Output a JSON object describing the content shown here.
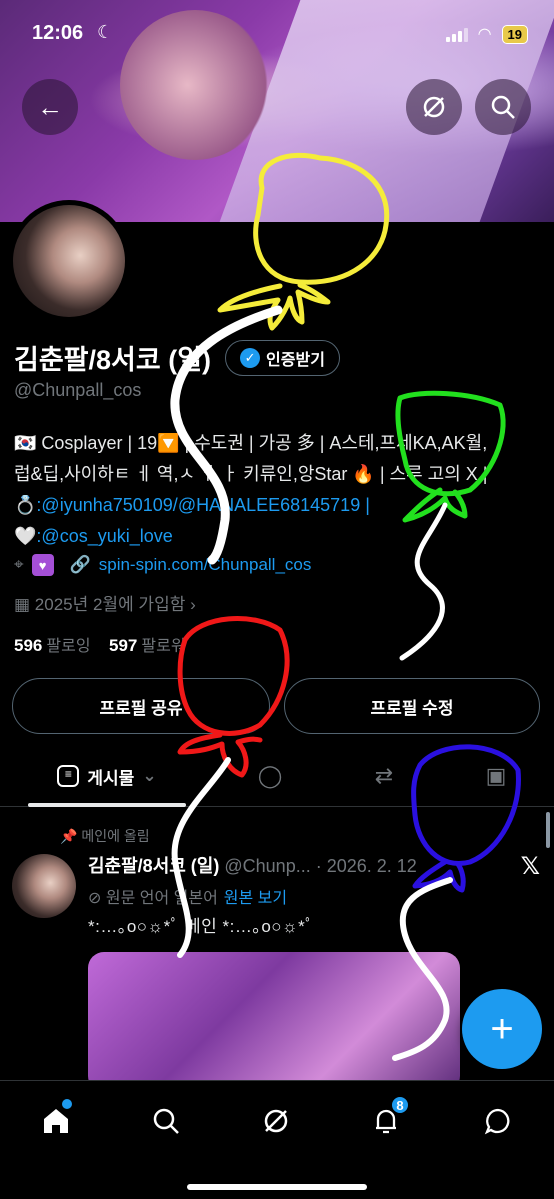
{
  "status": {
    "time": "12:06",
    "battery": "19"
  },
  "profile": {
    "name": "김춘팔/8서코 (일)",
    "verify_label": "인증받기",
    "handle": "@Chunpall_cos",
    "bio_line1": "🇰🇷 Cosplayer | 19🔽 | 수도권 | 가공 多 | A스테,프세KA,AK월,",
    "bio_line2": "럽&딥,사이하ㅌ ㅔ 역,ㅅ ㅔ ㅏ 키류인,앙Star 🔥 | 스루 고의 X |",
    "bio_ring": "💍",
    "bio_link1": ":@iyunha750109/",
    "bio_link2": "@HANALEE68145719 |",
    "bio_heart": "🤍",
    "bio_link3": ":@cos_yuki_love",
    "website": "spin-spin.com/Chunpall_cos",
    "joined": "2025년 2월에 가입함",
    "following_count": "596",
    "following_label": "팔로잉",
    "followers_count": "597",
    "followers_label": "팔로워"
  },
  "buttons": {
    "share": "프로필 공유",
    "edit": "프로필 수정"
  },
  "tabs": {
    "posts": "게시물"
  },
  "pinned": {
    "label": "메인에 올림",
    "name": "김춘팔/8서코 (일)",
    "handle": "@Chunp...",
    "date": "· 2026. 2. 12",
    "translate_text": "원문 언어 일본어",
    "translate_link": "원본 보기",
    "text": "*:…｡o○☼*ﾟ  메인  *:…｡o○☼*ﾟ"
  },
  "nav": {
    "notifications_badge": "8"
  },
  "drawing_colors": {
    "yellow": "#f5ec3a",
    "green": "#22e01e",
    "red": "#f01818",
    "blue": "#2a10e0",
    "white": "#ffffff"
  }
}
